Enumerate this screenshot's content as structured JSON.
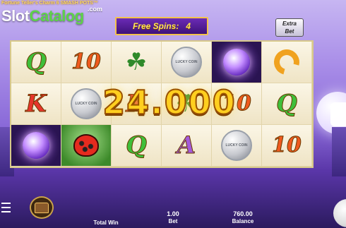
{
  "logo": {
    "game_name": "Fortune Teller's Charm 6 SMASH POTS™",
    "brand_part1": "Slot",
    "brand_part2": "Catalog",
    "brand_suffix": ".com"
  },
  "banner": {
    "free_spins_label": "Free Spins:",
    "free_spins_count": "4"
  },
  "extra_bet": {
    "line1": "Extra",
    "line2": "Bet"
  },
  "reels": [
    [
      {
        "sym": "letter",
        "text": "Q",
        "cls": "q"
      },
      {
        "sym": "letter",
        "text": "10",
        "cls": "ten"
      },
      {
        "sym": "clover"
      },
      {
        "sym": "coin",
        "text": "LUCKY COIN"
      },
      {
        "sym": "crystal"
      },
      {
        "sym": "horseshoe"
      }
    ],
    [
      {
        "sym": "letter",
        "text": "K",
        "cls": "k"
      },
      {
        "sym": "coin",
        "text": "LUCKY COIN"
      },
      {
        "sym": "letter",
        "text": "K",
        "cls": "k"
      },
      {
        "sym": "clover"
      },
      {
        "sym": "letter",
        "text": "10",
        "cls": "ten"
      },
      {
        "sym": "letter",
        "text": "Q",
        "cls": "q"
      }
    ],
    [
      {
        "sym": "crystal"
      },
      {
        "sym": "ladybug"
      },
      {
        "sym": "letter",
        "text": "Q",
        "cls": "q"
      },
      {
        "sym": "letter",
        "text": "A",
        "cls": "a"
      },
      {
        "sym": "coin",
        "text": "LUCKY COIN"
      },
      {
        "sym": "letter",
        "text": "10",
        "cls": "ten"
      }
    ]
  ],
  "win_amount": "24.000",
  "footer": {
    "total_win_label": "Total Win",
    "total_win_value": "",
    "bet_label": "Bet",
    "bet_value": "1.00",
    "balance_label": "Balance",
    "balance_value": "760.00"
  }
}
